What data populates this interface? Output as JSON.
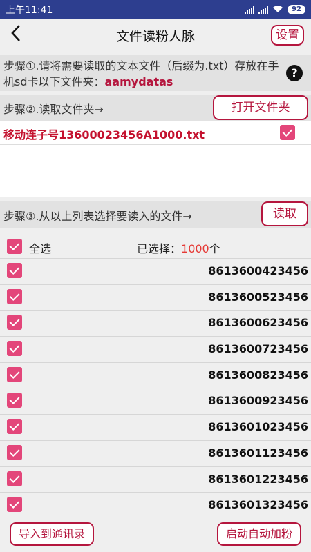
{
  "status": {
    "time": "上午11:41",
    "signal": "…",
    "wifi": "wifi-icon",
    "battery": "92"
  },
  "header": {
    "title": "文件读粉人脉",
    "settings_label": "设置"
  },
  "step1": {
    "text": "步骤①.请将需要读取的文本文件（后缀为.txt）存放在手机sd卡以下文件夹：",
    "folder": "aamydatas",
    "help": "?"
  },
  "step2": {
    "text": "步骤②.读取文件夹→",
    "button_label": "打开文件夹"
  },
  "files": [
    {
      "name": "移动连子号13600023456A1000.txt",
      "checked": true
    }
  ],
  "step3": {
    "text": "步骤③.从以上列表选择要读入的文件→",
    "button_label": "读取"
  },
  "selection": {
    "select_all_label": "全选",
    "selected_prefix": "已选择：",
    "count": "1000",
    "unit": "个"
  },
  "numbers": [
    "8613600423456",
    "8613600523456",
    "8613600623456",
    "8613600723456",
    "8613600823456",
    "8613600923456",
    "8613601023456",
    "8613601123456",
    "8613601223456",
    "8613601323456"
  ],
  "footer": {
    "import_label": "导入到通讯录",
    "auto_label": "启动自动加粉"
  },
  "colors": {
    "accent": "#b5163e",
    "checkbox": "#e3467a",
    "statusbar": "#2d3e8f",
    "count": "#e53935"
  }
}
